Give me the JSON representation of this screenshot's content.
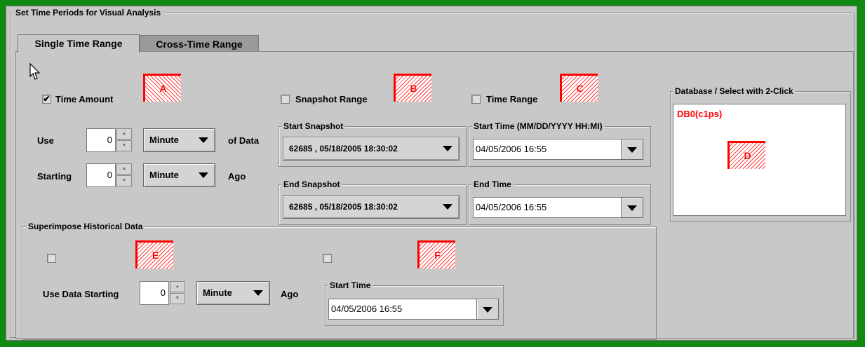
{
  "window": {
    "title": "Set Time Periods for Visual Analysis"
  },
  "tabs": [
    {
      "label": "Single Time Range",
      "active": true
    },
    {
      "label": "Cross-Time Range",
      "active": false
    }
  ],
  "time_amount": {
    "checkbox_label": "Time Amount",
    "checked": true,
    "checkmark": "✔",
    "marker": "A",
    "use_label": "Use",
    "use_value": "0",
    "use_unit": "Minute",
    "of_data_label": "of Data",
    "starting_label": "Starting",
    "starting_value": "0",
    "starting_unit": "Minute",
    "ago_label": "Ago"
  },
  "snapshot_range": {
    "checkbox_label": "Snapshot Range",
    "checked": false,
    "marker": "B",
    "start_legend": "Start Snapshot",
    "start_value": "62685 , 05/18/2005 18:30:02",
    "end_legend": "End Snapshot",
    "end_value": "62685 , 05/18/2005 18:30:02"
  },
  "time_range": {
    "checkbox_label": "Time Range",
    "checked": false,
    "marker": "C",
    "start_legend": "Start Time (MM/DD/YYYY HH:MI)",
    "start_value": "04/05/2006 16:55",
    "end_legend": "End Time",
    "end_value": "04/05/2006 16:55"
  },
  "database": {
    "legend": "Database / Select with 2-Click",
    "items": [
      "DB0(c1ps)"
    ],
    "marker": "D",
    "item_color": "#ff0000"
  },
  "superimpose": {
    "legend": "Superimpose Historical Data",
    "left_checked": false,
    "left_marker": "E",
    "use_data_starting_label": "Use Data Starting",
    "value": "0",
    "unit": "Minute",
    "ago_label": "Ago",
    "right_checked": false,
    "right_marker": "F",
    "start_time_legend": "Start Time",
    "start_time_value": "04/05/2006 16:55"
  },
  "colors": {
    "background": "#118a11",
    "panel": "#c8c8c8",
    "marker": "#ff0000"
  }
}
